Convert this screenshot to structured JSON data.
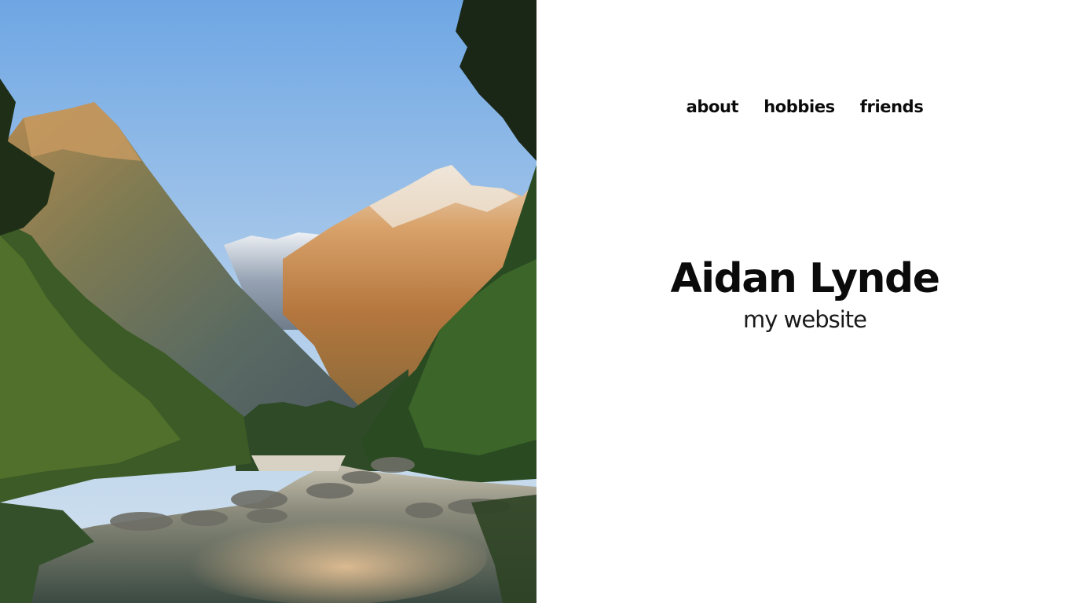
{
  "nav": {
    "items": [
      {
        "label": "about"
      },
      {
        "label": "hobbies"
      },
      {
        "label": "friends"
      }
    ]
  },
  "hero": {
    "title": "Aidan Lynde",
    "subtitle": "my website"
  },
  "colors": {
    "text": "#0b0b0b",
    "background": "#ffffff",
    "sky_top": "#6ea6e4",
    "sky_bottom": "#cfe0ee"
  }
}
